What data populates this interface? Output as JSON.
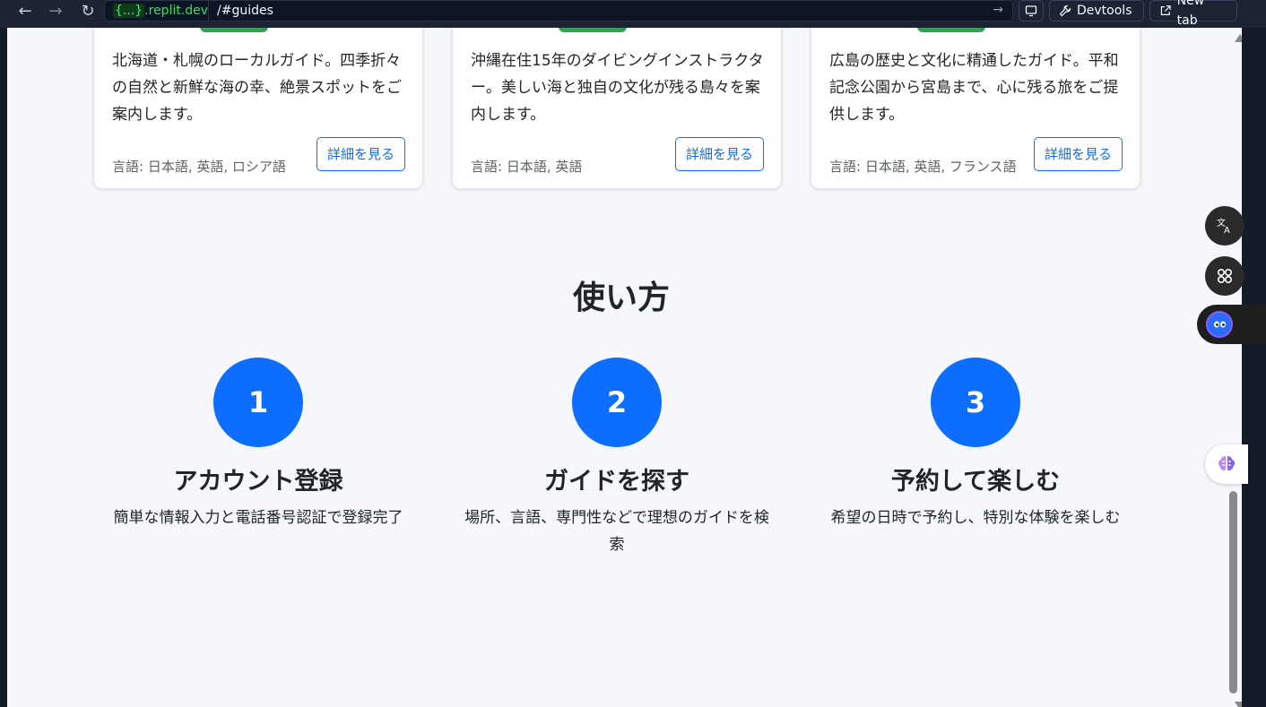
{
  "browser": {
    "url_domain_brace": "{...}",
    "url_domain_rest": ".replit.dev",
    "url_path": "/#guides",
    "devtools_label": "Devtools",
    "newtab_label": "New tab"
  },
  "cards": [
    {
      "description": "北海道・札幌のローカルガイド。四季折々の自然と新鮮な海の幸、絶景スポットをご案内します。",
      "languages": "言語: 日本語, 英語, ロシア語",
      "button": "詳細を見る"
    },
    {
      "description": "沖縄在住15年のダイビングインストラクター。美しい海と独自の文化が残る島々を案内します。",
      "languages": "言語: 日本語, 英語",
      "button": "詳細を見る"
    },
    {
      "description": "広島の歴史と文化に精通したガイド。平和記念公園から宮島まで、心に残る旅をご提供します。",
      "languages": "言語: 日本語, 英語, フランス語",
      "button": "詳細を見る"
    }
  ],
  "how_to": {
    "title": "使い方",
    "steps": [
      {
        "number": "1",
        "title": "アカウント登録",
        "desc": "簡単な情報入力と電話番号認証で登録完了"
      },
      {
        "number": "2",
        "title": "ガイドを探す",
        "desc": "場所、言語、専門性などで理想のガイドを検索"
      },
      {
        "number": "3",
        "title": "予約して楽しむ",
        "desc": "希望の日時で予約し、特別な体験を楽しむ"
      }
    ]
  },
  "colors": {
    "primary": "#0d6efd",
    "tag_green": "#28a745",
    "page_bg": "#f5f7fa",
    "chrome_bg": "#1c2333"
  },
  "icons": {
    "back": "arrow-left-icon",
    "forward": "arrow-right-icon",
    "reload": "reload-icon",
    "go": "arrow-right-icon",
    "monitor": "monitor-icon",
    "devtools": "wrench-icon",
    "new_tab": "external-link-icon",
    "translate": "translate-icon",
    "apps": "apps-grid-icon",
    "assistant": "assistant-face-icon",
    "brain": "brain-icon"
  }
}
